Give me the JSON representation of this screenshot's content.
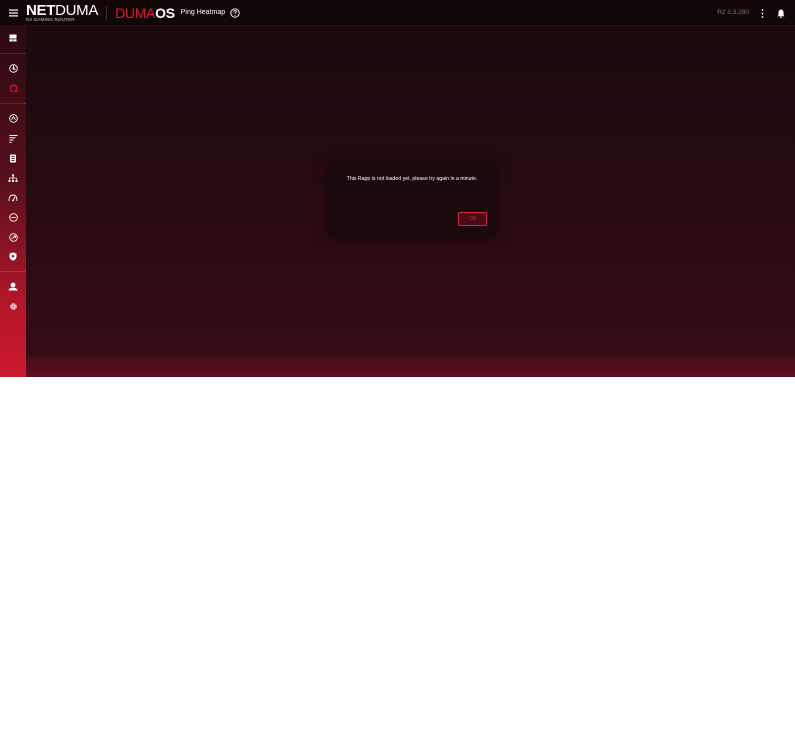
{
  "header": {
    "logo_net": "NET",
    "logo_duma": "DUMA",
    "logo_tagline": "R2 GAMING ROUTER",
    "os_duma": "DUMA",
    "os_os": "OS",
    "page_title": "Ping Heatmap",
    "version": "R2 3.3.280",
    "icons": {
      "menu": "hamburger-menu-icon",
      "help": "help-circle-icon",
      "more": "more-vertical-icon",
      "notifications": "bell-icon"
    }
  },
  "sidebar": {
    "items": [
      {
        "name": "dashboard",
        "icon": "dashboard-icon",
        "active": false
      },
      {
        "name": "geo-filter",
        "icon": "geo-filter-icon",
        "active": false
      },
      {
        "name": "ping-heatmap",
        "icon": "ping-heatmap-icon",
        "active": true
      },
      {
        "name": "network-monitor",
        "icon": "network-monitor-icon",
        "active": false
      },
      {
        "name": "traffic-prioritization",
        "icon": "traffic-prioritization-icon",
        "active": false
      },
      {
        "name": "qos",
        "icon": "qos-icon",
        "active": false
      },
      {
        "name": "device-manager",
        "icon": "device-manager-icon",
        "active": false
      },
      {
        "name": "speed-test",
        "icon": "speed-test-icon",
        "active": false
      },
      {
        "name": "ad-block",
        "icon": "ad-block-icon",
        "active": false
      },
      {
        "name": "network-speed",
        "icon": "network-speed-icon",
        "active": false
      },
      {
        "name": "security",
        "icon": "shield-icon",
        "active": false
      },
      {
        "name": "user",
        "icon": "user-icon",
        "active": false
      },
      {
        "name": "settings",
        "icon": "gear-icon",
        "active": false
      }
    ],
    "colors": {
      "active_icon": "#e0192d",
      "icon": "#ffffff"
    }
  },
  "dialog": {
    "message": "This Rapp is not loaded yet, please try again in a minute.",
    "ok_label": "OK"
  },
  "colors": {
    "accent": "#e0192d",
    "background": "#1c0a0d",
    "sidebar_bottom": "#cc1a30"
  }
}
